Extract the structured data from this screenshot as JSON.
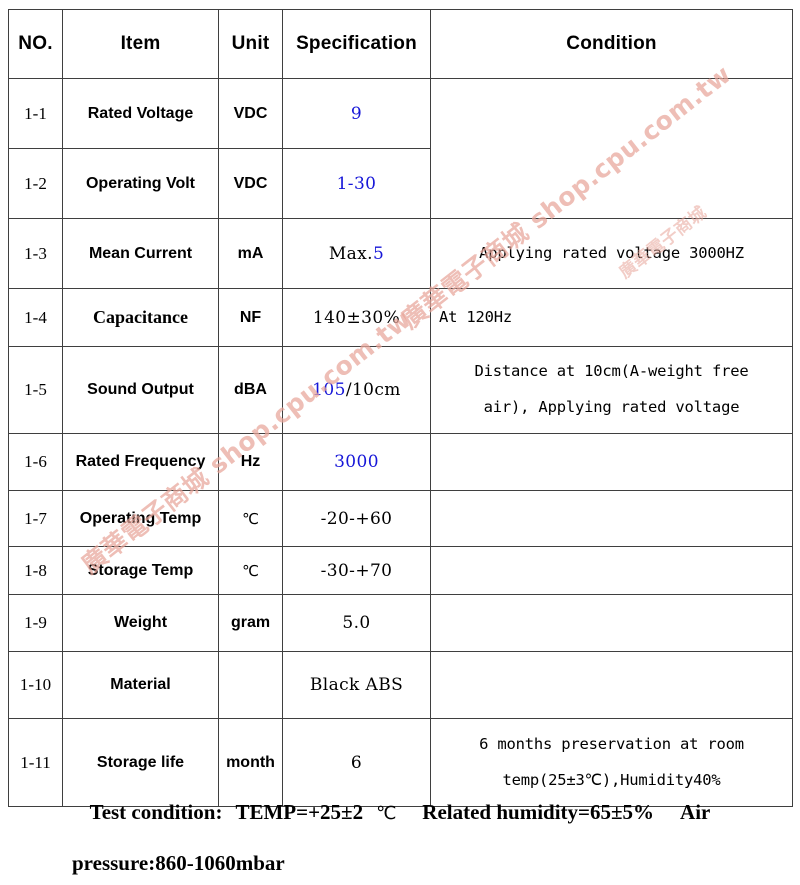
{
  "table": {
    "headers": [
      "NO.",
      "Item",
      "Unit",
      "Specification",
      "Condition"
    ],
    "rows": [
      {
        "no": "1-1",
        "item": "Rated Voltage",
        "unit": "VDC",
        "spec_blue": "9",
        "spec_black": "",
        "condition": ""
      },
      {
        "no": "1-2",
        "item": "Operating Volt",
        "unit": "VDC",
        "spec_blue": "1-30",
        "spec_black": "",
        "condition": ""
      },
      {
        "no": "1-3",
        "item": "Mean Current",
        "unit": "mA",
        "spec_black": "Max.",
        "spec_blue": "5",
        "condition": "Applying rated voltage 3000HZ"
      },
      {
        "no": "1-4",
        "item": "Capacitance",
        "unit": "NF",
        "spec_black": "140±30%",
        "spec_blue": "",
        "condition": "At 120Hz"
      },
      {
        "no": "1-5",
        "item": "Sound Output",
        "unit": "dBA",
        "spec_blue": "105",
        "spec_black": "/10cm",
        "condition_line1": "Distance at 10cm(A-weight free",
        "condition_line2": "air), Applying rated voltage"
      },
      {
        "no": "1-6",
        "item": "Rated Frequency",
        "unit": "Hz",
        "spec_blue": "3000",
        "spec_black": "",
        "condition": ""
      },
      {
        "no": "1-7",
        "item": "Operating Temp",
        "unit": "℃",
        "spec_black": "-20-+60",
        "spec_blue": "",
        "condition": ""
      },
      {
        "no": "1-8",
        "item": "Storage Temp",
        "unit": "℃",
        "spec_black": "-30-+70",
        "spec_blue": "",
        "condition": ""
      },
      {
        "no": "1-9",
        "item": "Weight",
        "unit": "gram",
        "spec_black": "5.0",
        "spec_blue": "",
        "condition": ""
      },
      {
        "no": "1-10",
        "item": "Material",
        "unit": "",
        "spec_black": "Black ABS",
        "spec_blue": "",
        "condition": ""
      },
      {
        "no": "1-11",
        "item": "Storage life",
        "unit": "month",
        "spec_black": "6",
        "spec_blue": "",
        "condition_line1": "6 months preservation at room",
        "condition_line2": "temp(25±3℃),Humidity40%"
      }
    ]
  },
  "footer": {
    "test_condition_label": "Test  condition:",
    "temp": "TEMP=+25±2",
    "temp_unit": "℃",
    "humidity": "Related  humidity=65±5%",
    "air_label": "Air",
    "pressure": "pressure:860-1060mbar"
  },
  "watermark": {
    "text_a": "廣華電子商城 shop.cpu.com.tw",
    "text_b": "廣華電子商城 shop.cpu.com.tw",
    "text_c": "廣華電子商城",
    "color": "#e8a69a"
  },
  "colors": {
    "spec_value_blue": "#1616d8",
    "text_black": "#000000",
    "border": "#3f3f3f",
    "background": "#ffffff"
  }
}
